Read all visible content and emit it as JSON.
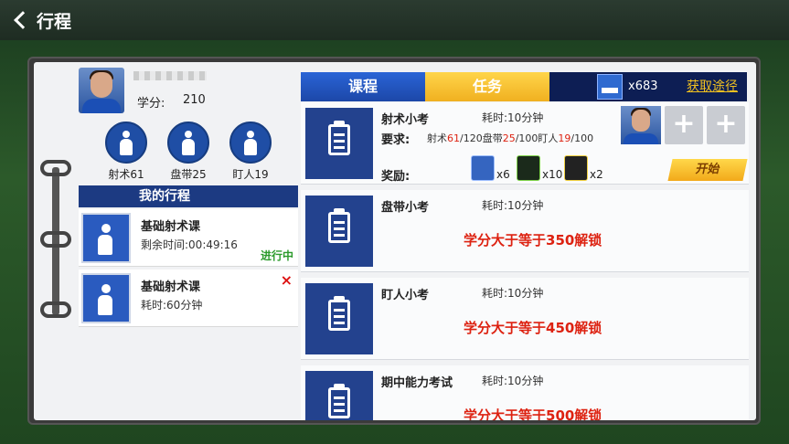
{
  "header": {
    "title": "行程"
  },
  "profile": {
    "score_label": "学分:",
    "score_value": "210"
  },
  "skills": [
    {
      "label": "射术61"
    },
    {
      "label": "盘带25"
    },
    {
      "label": "盯人19"
    }
  ],
  "schedule": {
    "title": "我的行程",
    "items": [
      {
        "title": "基础射术课",
        "detail": "剩余时间:00:49:16",
        "status": "进行中"
      },
      {
        "title": "基础射术课",
        "detail": "耗时:60分钟",
        "close": "×"
      }
    ]
  },
  "tabs": {
    "course": "课程",
    "task": "任务"
  },
  "currency": {
    "count": "x683",
    "get_link": "获取途径"
  },
  "tasks": [
    {
      "name": "射术小考",
      "time": "耗时:10分钟",
      "req_label": "要求:",
      "req": {
        "a_name": "射术",
        "a_cur": "61",
        "a_max": "/120",
        "b_name": "盘带",
        "b_cur": "25",
        "b_max": "/100",
        "c_name": "盯人",
        "c_cur": "19",
        "c_max": "/100"
      },
      "reward_label": "奖励:",
      "rewards": [
        {
          "qty": "x6"
        },
        {
          "qty": "x10"
        },
        {
          "qty": "x2"
        }
      ],
      "start": "开始",
      "add_symbol": "+"
    },
    {
      "name": "盘带小考",
      "time": "耗时:10分钟",
      "lock": "学分大于等于350解锁"
    },
    {
      "name": "盯人小考",
      "time": "耗时:10分钟",
      "lock": "学分大于等于450解锁"
    },
    {
      "name": "期中能力考试",
      "time": "耗时:10分钟",
      "lock": "学分大于等于500解锁"
    }
  ],
  "colors": {
    "accent_blue": "#1c3a82",
    "gold": "#f0b020",
    "lock_red": "#d21",
    "status_green": "#2b9a2b"
  }
}
